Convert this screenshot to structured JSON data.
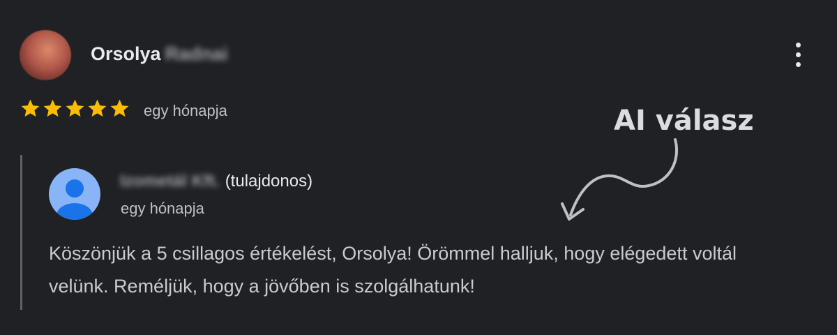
{
  "review": {
    "reviewer_first_name": "Orsolya",
    "reviewer_last_name_blurred": "Radnai",
    "rating": 5,
    "rating_max": 5,
    "time": "egy hónapja"
  },
  "reply": {
    "owner_name_blurred": "Izometál Kft.",
    "owner_role": "(tulajdonos)",
    "time": "egy hónapja",
    "text": "Köszönjük a 5 csillagos értékelést, Orsolya! Örömmel halljuk, hogy elégedett voltál velünk. Reméljük, hogy a jövőben is szolgálhatunk!"
  },
  "annotation": {
    "label": "AI válasz"
  },
  "icons": {
    "more": "more-vert-icon",
    "star": "star-icon",
    "default_avatar": "person-avatar-icon"
  },
  "colors": {
    "background": "#202124",
    "star": "#fbbc04",
    "default_avatar_bg": "#8ab4f8",
    "default_avatar_fg": "#1a73e8"
  }
}
